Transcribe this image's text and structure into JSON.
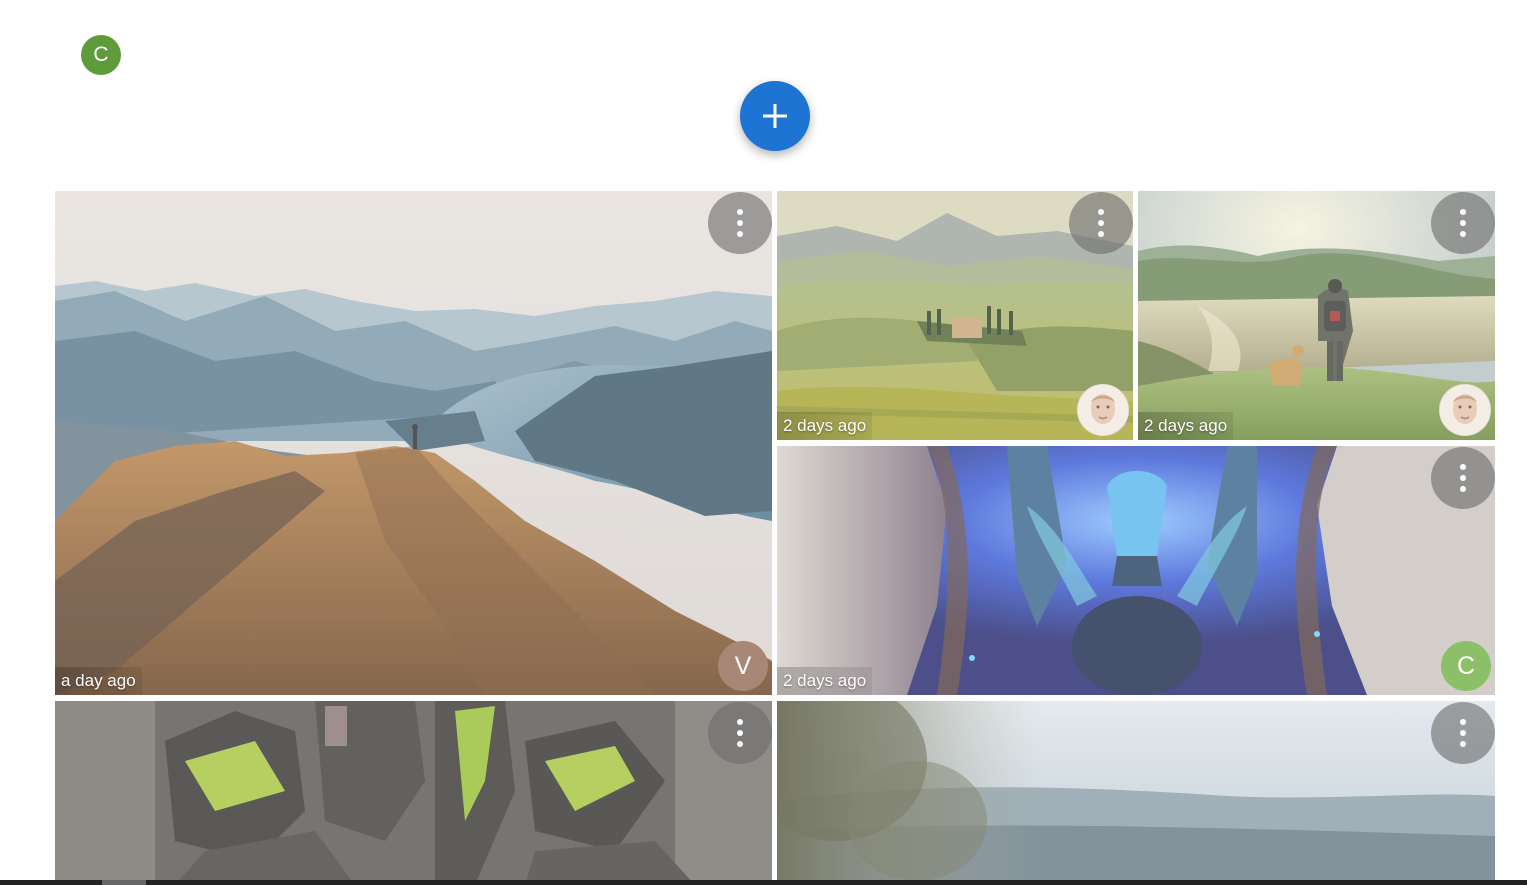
{
  "header": {
    "user_avatar_letter": "C",
    "add_button_icon": "plus-icon"
  },
  "colors": {
    "accent": "#1d74d2",
    "user_avatar": "#5e9b3a",
    "avatar_v": "#a98776",
    "avatar_c": "#8cc068"
  },
  "gallery": {
    "tiles": [
      {
        "subject": "mountain-ridge-lake",
        "time": "a day ago",
        "owner_letter": "V"
      },
      {
        "subject": "tuscany-hills",
        "time": "2 days ago",
        "owner_letter": ""
      },
      {
        "subject": "hiker-with-dog",
        "time": "2 days ago",
        "owner_letter": ""
      },
      {
        "subject": "blue-crystal-artwork",
        "time": "2 days ago",
        "owner_letter": "C"
      },
      {
        "subject": "green-armor-closeup",
        "time": "",
        "owner_letter": ""
      },
      {
        "subject": "blurred-landscape",
        "time": "",
        "owner_letter": ""
      }
    ]
  }
}
